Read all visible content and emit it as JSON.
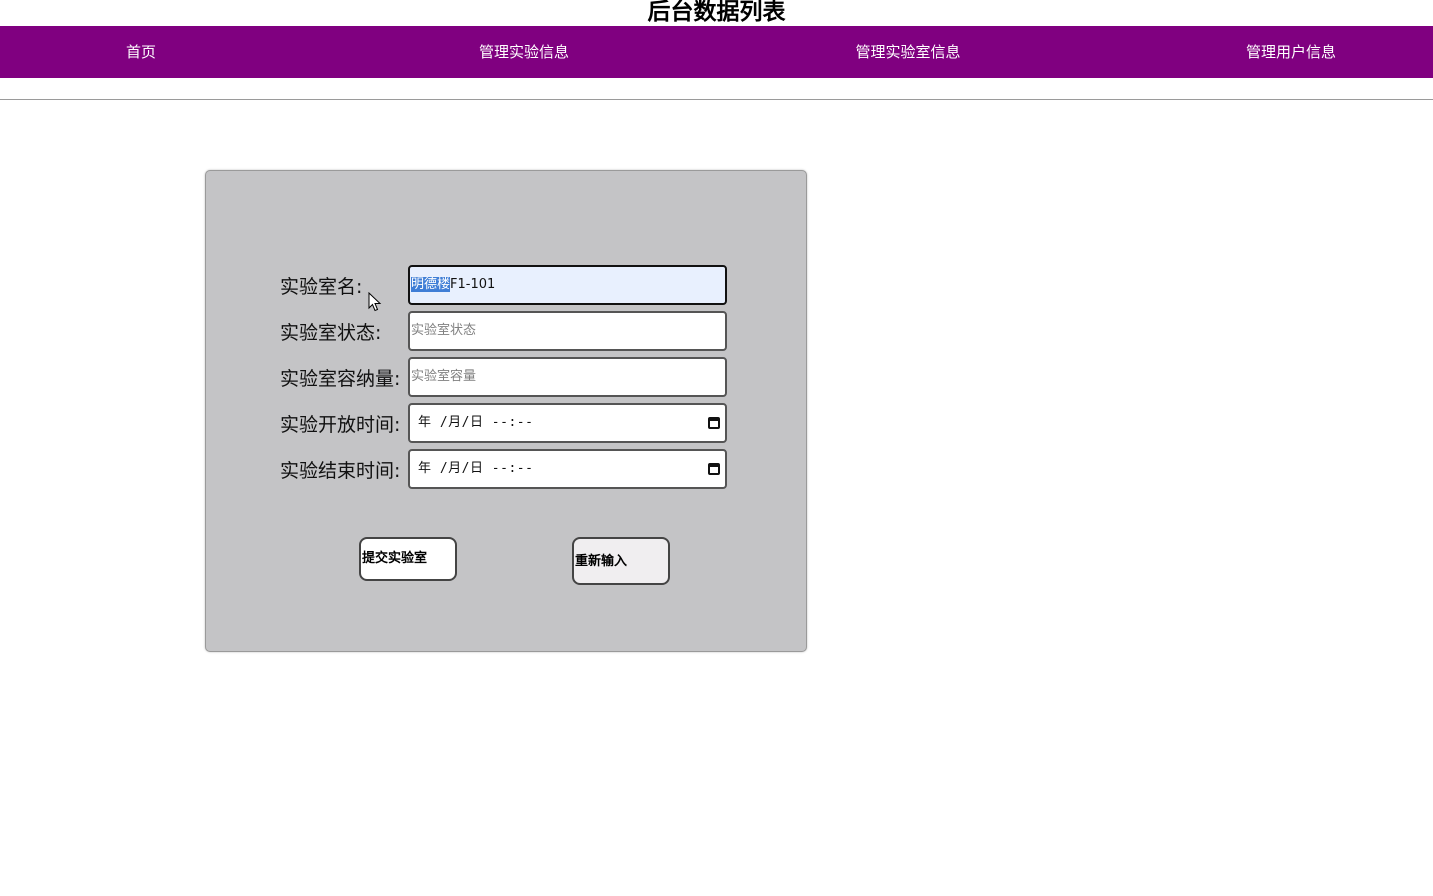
{
  "header": {
    "title": "后台数据列表"
  },
  "nav": {
    "items": [
      {
        "label": "首页"
      },
      {
        "label": "管理实验信息"
      },
      {
        "label": "管理实验室信息"
      },
      {
        "label": "管理用户信息"
      }
    ]
  },
  "form": {
    "fields": [
      {
        "label": "实验室名:",
        "value_selected": "明德楼",
        "value_rest": "F1-101",
        "placeholder": ""
      },
      {
        "label": "实验室状态:",
        "value": "",
        "placeholder": "实验室状态"
      },
      {
        "label": "实验室容纳量:",
        "value": "",
        "placeholder": "实验室容量"
      },
      {
        "label": "实验开放时间:",
        "display": "年 /月/日 --:--"
      },
      {
        "label": "实验结束时间:",
        "display": "年 /月/日 --:--"
      }
    ],
    "submit_label": "提交实验室",
    "reset_label": "重新输入"
  },
  "colors": {
    "navbar": "#800080",
    "panel": "#c4c4c6",
    "selection": "#3f7ed6"
  },
  "icons": {
    "calendar": "calendar-icon",
    "cursor": "mouse-pointer-icon"
  }
}
